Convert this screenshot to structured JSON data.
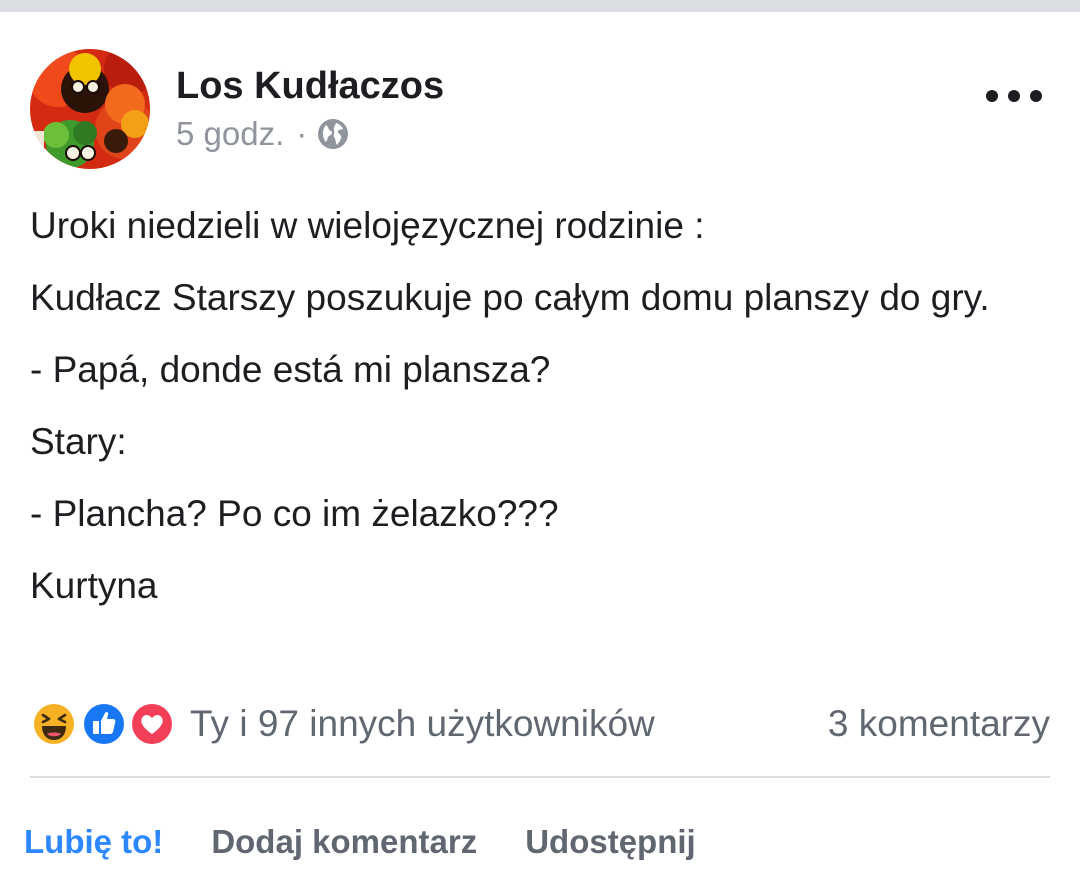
{
  "post": {
    "author": "Los Kudłaczos",
    "time": "5 godz.",
    "separator": "·",
    "privacy_icon": "globe-icon",
    "menu_icon": "more-options-icon",
    "body": [
      "Uroki niedzieli w wielojęzycznej rodzinie :",
      "Kudłacz Starszy poszukuje po całym domu planszy do gry.",
      "- Papá, donde está mi plansza?",
      "Stary:",
      "- Plancha? Po co im żelazko???",
      "Kurtyna"
    ]
  },
  "reactions": {
    "icons": [
      "haha-reaction-icon",
      "like-reaction-icon",
      "love-reaction-icon"
    ],
    "summary": "Ty i 97 innych użytkowników",
    "comments": "3 komentarzy"
  },
  "actions": {
    "like": "Lubię to!",
    "comment": "Dodaj komentarz",
    "share": "Udostępnij"
  },
  "colors": {
    "accent": "#2d88ff",
    "text_primary": "#1c1e21",
    "text_secondary": "#606770",
    "divider": "#dadde1"
  }
}
